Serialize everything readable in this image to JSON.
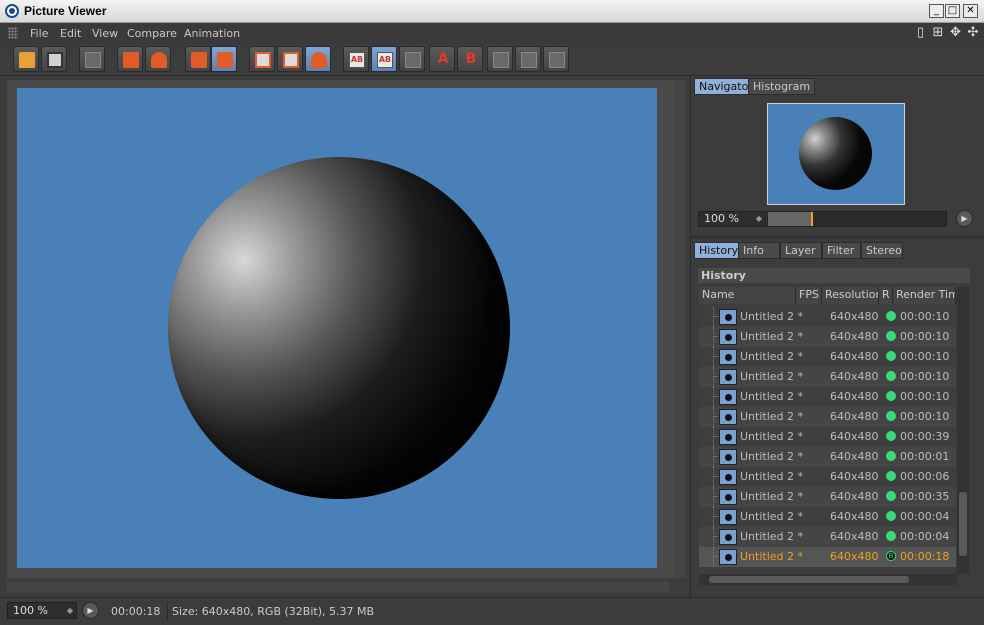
{
  "window": {
    "title": "Picture Viewer",
    "minimize": "_",
    "maximize": "□",
    "close": "✕"
  },
  "menu": [
    "File",
    "Edit",
    "View",
    "Compare",
    "Animation"
  ],
  "layout_icons": [
    "▯",
    "⊞",
    "✥",
    "✣"
  ],
  "navigator": {
    "tabs": [
      "Navigator",
      "Histogram"
    ],
    "zoom_value": "100 %",
    "zoom_slider_level": 0.24
  },
  "history": {
    "tabs": [
      "History",
      "Info",
      "Layer",
      "Filter",
      "Stereo"
    ],
    "header": "History",
    "columns": [
      "Name",
      "FPS",
      "Resolution",
      "R",
      "Render Tim"
    ],
    "rows": [
      {
        "name": "Untitled 2 *",
        "fps": "",
        "resolution": "640x480",
        "status": "dot",
        "time": "00:00:10"
      },
      {
        "name": "Untitled 2 *",
        "fps": "",
        "resolution": "640x480",
        "status": "dot",
        "time": "00:00:10"
      },
      {
        "name": "Untitled 2 *",
        "fps": "",
        "resolution": "640x480",
        "status": "dot",
        "time": "00:00:10"
      },
      {
        "name": "Untitled 2 *",
        "fps": "",
        "resolution": "640x480",
        "status": "dot",
        "time": "00:00:10"
      },
      {
        "name": "Untitled 2 *",
        "fps": "",
        "resolution": "640x480",
        "status": "dot",
        "time": "00:00:10"
      },
      {
        "name": "Untitled 2 *",
        "fps": "",
        "resolution": "640x480",
        "status": "dot",
        "time": "00:00:10"
      },
      {
        "name": "Untitled 2 *",
        "fps": "",
        "resolution": "640x480",
        "status": "dot",
        "time": "00:00:39"
      },
      {
        "name": "Untitled 2 *",
        "fps": "",
        "resolution": "640x480",
        "status": "dot",
        "time": "00:00:01"
      },
      {
        "name": "Untitled 2 *",
        "fps": "",
        "resolution": "640x480",
        "status": "dot",
        "time": "00:00:06"
      },
      {
        "name": "Untitled 2 *",
        "fps": "",
        "resolution": "640x480",
        "status": "dot",
        "time": "00:00:35"
      },
      {
        "name": "Untitled 2 *",
        "fps": "",
        "resolution": "640x480",
        "status": "dot",
        "time": "00:00:04"
      },
      {
        "name": "Untitled 2 *",
        "fps": "",
        "resolution": "640x480",
        "status": "dot",
        "time": "00:00:04"
      },
      {
        "name": "Untitled 2 *",
        "fps": "",
        "resolution": "640x480",
        "status": "B",
        "time": "00:00:18",
        "selected": true
      }
    ]
  },
  "status": {
    "zoom": "100 %",
    "time": "00:00:18",
    "info": "Size: 640x480, RGB (32Bit), 5.37 MB"
  },
  "toolbar_letters": {
    "a": "A",
    "b": "B"
  },
  "colors": {
    "canvas_bg": "#4a80b8",
    "accent_orange": "#f0a020",
    "status_green": "#3adc7a"
  }
}
